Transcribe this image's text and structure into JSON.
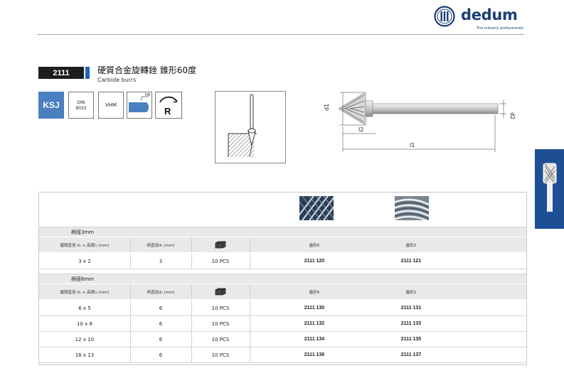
{
  "brand": {
    "name": "dedum",
    "tagline": "The industry professionals"
  },
  "product": {
    "code": "2111",
    "title_cn": "硬質合金旋轉銼 錐形60度",
    "title_en": "Carbide burrs"
  },
  "badges": {
    "ksj": "KSJ",
    "din_line1": "DIN",
    "din_line2": "8033",
    "vhm": "VHM",
    "ha": "HA",
    "r": "R"
  },
  "drawing": {
    "d1": "d1",
    "d2": "d2",
    "l1": "l1",
    "l2": "l2"
  },
  "table": {
    "headers": {
      "size": "磨頭直徑 d₁ × 高度l₂ (mm)",
      "shank": "柄直徑d₂ (mm)",
      "cut_a": "齒形6",
      "cut_b": "齒形2"
    },
    "sections": [
      {
        "label": "柄徑3mm",
        "rows": [
          {
            "size": "3 x 2",
            "shank": "3",
            "pack": "10  PCS",
            "code_a": "2111 120",
            "code_b": "2111 121"
          }
        ]
      },
      {
        "label": "柄徑6mm",
        "rows": [
          {
            "size": "6 x 5",
            "shank": "6",
            "pack": "10  PCS",
            "code_a": "2111 130",
            "code_b": "2111 131"
          },
          {
            "size": "10 x 8",
            "shank": "6",
            "pack": "10  PCS",
            "code_a": "2111 132",
            "code_b": "2111 133"
          },
          {
            "size": "12 x 10",
            "shank": "6",
            "pack": "10  PCS",
            "code_a": "2111 134",
            "code_b": "2111 135"
          },
          {
            "size": "16 x 13",
            "shank": "6",
            "pack": "10  PCS",
            "code_a": "2111 136",
            "code_b": "2111 137"
          }
        ]
      }
    ]
  },
  "icons": [
    "dedum-logo-icon",
    "end-face-icon",
    "rotation-arrow-icon",
    "box-icon",
    "cut-pattern-6-icon",
    "cut-pattern-2-icon",
    "burr-tab-icon"
  ],
  "colors": {
    "brand": "#1c3f75",
    "accent": "#1e63b4",
    "ksj": "#4a7fc0",
    "tab": "#1e4f94",
    "header_bg": "#e9e9e9"
  }
}
